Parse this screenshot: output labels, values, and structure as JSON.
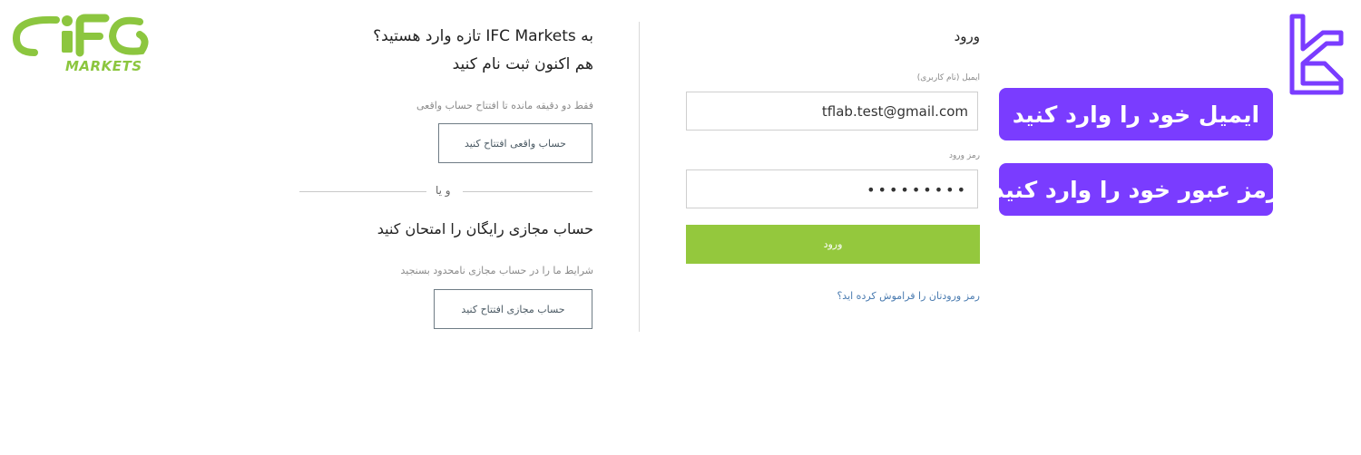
{
  "logo": {
    "brand": "IFC",
    "sub": "MARKETS",
    "color": "#8cc63f"
  },
  "promo": {
    "title": "به IFC Markets تازه وارد هستید؟",
    "subtitle": "هم اکنون ثبت نام کنید",
    "real_hint": "فقط دو دقیقه مانده تا افتتاح حساب واقعی",
    "real_button": "حساب واقعی افتتاح کنید",
    "or_text": "و یا",
    "demo_title": "حساب مجازی رایگان را امتحان کنید",
    "demo_hint": "شرایط ما را در حساب مجازی نامحدود بسنجید",
    "demo_button": "حساب مجازی افتتاح کنید"
  },
  "login": {
    "title": "ورود",
    "email_label": "ایمیل (نام کاربری)",
    "email_value": "tflab.test@gmail.com",
    "password_label": "رمز ورود",
    "password_value": "•••••••••",
    "submit_label": "ورود",
    "forgot_link": "رمز ورودتان را فراموش کرده اید؟",
    "button_color": "#94c83d"
  },
  "callouts": {
    "email": "ایمیل خود را وارد کنید",
    "password": "رمز عبور خود را وارد کنید",
    "color": "#7a3cff"
  }
}
